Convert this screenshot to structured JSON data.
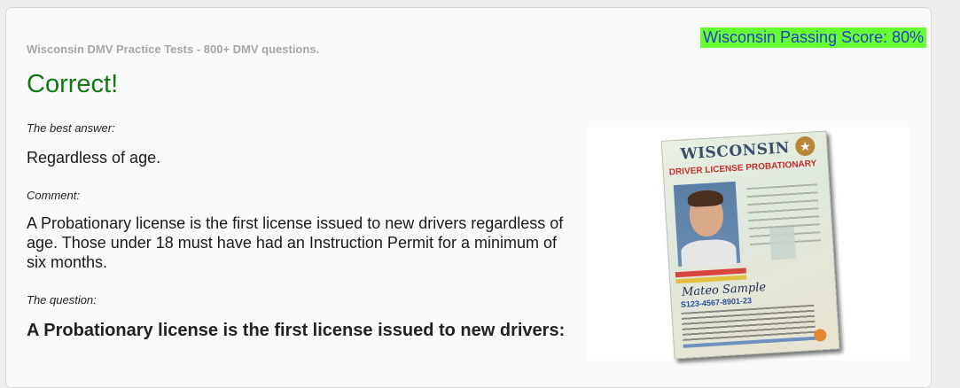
{
  "header": {
    "site_title": "Wisconsin DMV Practice Tests - 800+ DMV questions.",
    "passing_score": "Wisconsin Passing Score: 80%"
  },
  "result": {
    "status": "Correct!"
  },
  "answer": {
    "label": "The best answer:",
    "text": "Regardless of age."
  },
  "comment": {
    "label": "Comment:",
    "text": "A Probationary license is the first license issued to new drivers regardless of age. Those under 18 must have had an Instruction Permit for a minimum of six months."
  },
  "question": {
    "label": "The question:",
    "text": "A Probationary license is the first license issued to new drivers:"
  },
  "image": {
    "license_state": "WISCONSIN",
    "license_type": "DRIVER LICENSE PROBATIONARY",
    "license_number": "S123-4567-8901-23",
    "signature": "Mateo Sample"
  },
  "colors": {
    "correct": "#117a11",
    "score_bg": "#66ff33",
    "score_text": "#2a3acc",
    "site_title": "#a6a6a6"
  }
}
